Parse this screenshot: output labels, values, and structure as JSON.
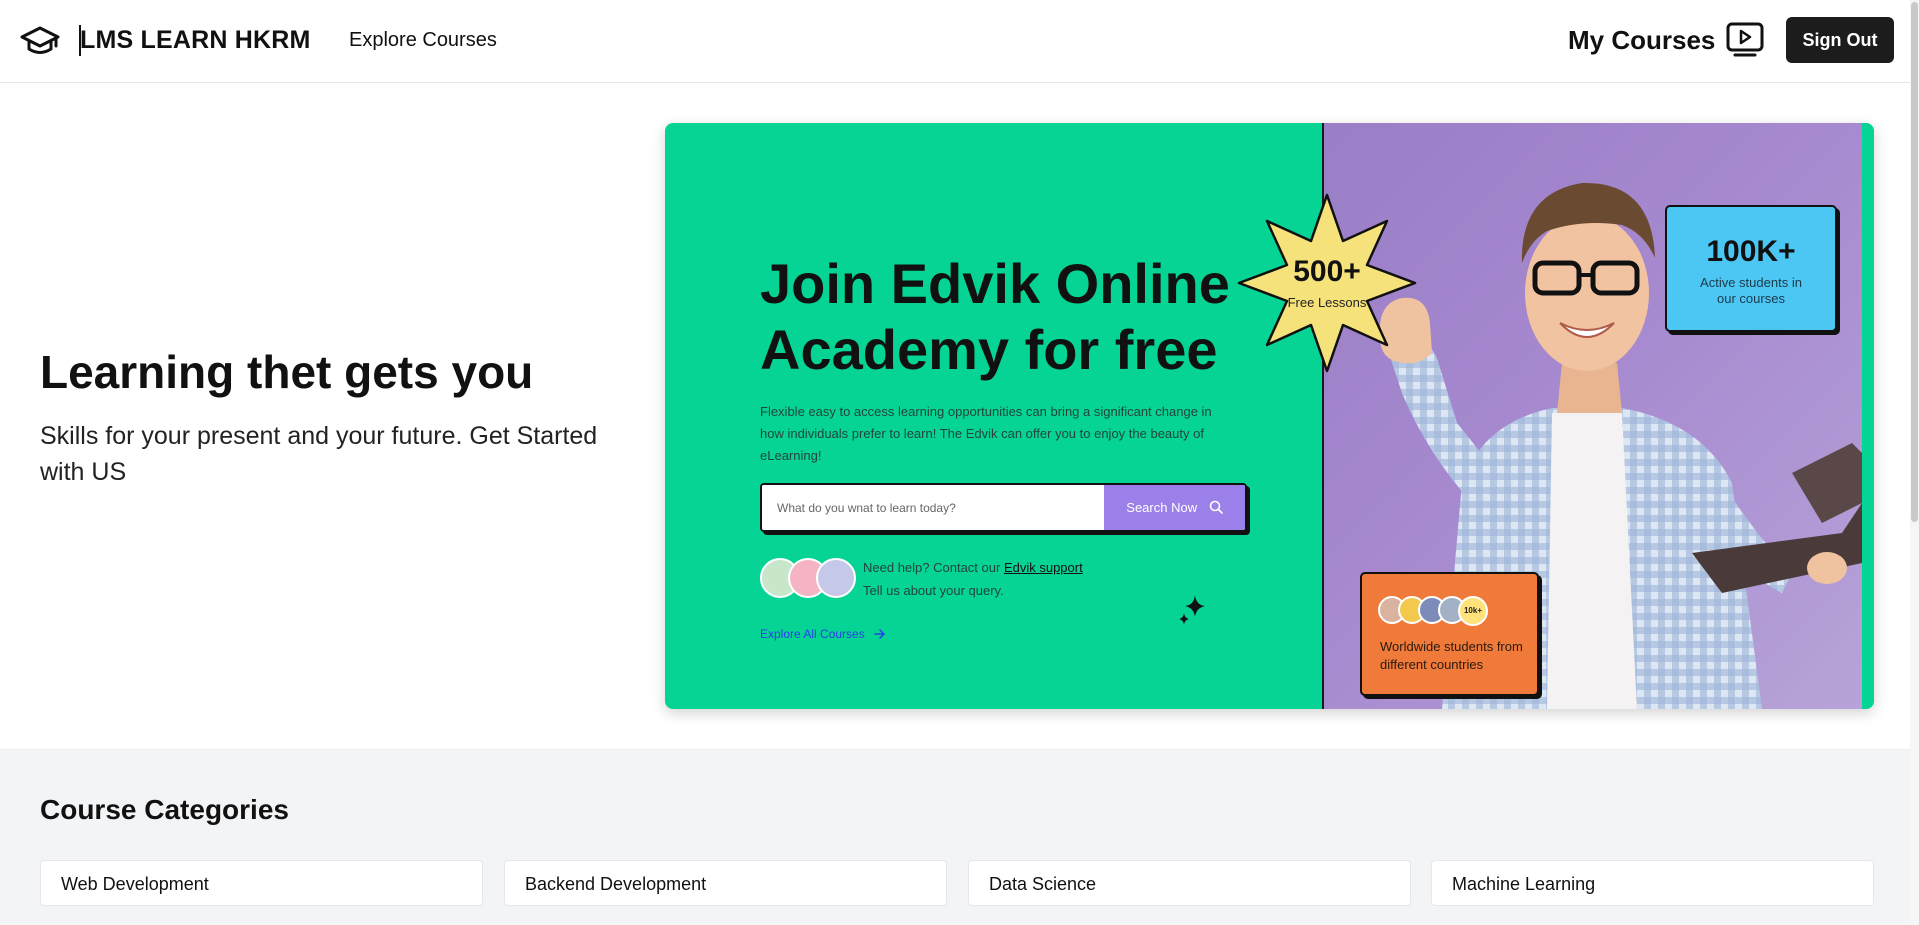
{
  "header": {
    "brand": "LMS LEARN HKRM",
    "nav_explore": "Explore Courses",
    "my_courses": "My Courses",
    "sign_out": "Sign Out",
    "icons": [
      "graduation-cap-icon",
      "play-screen-icon"
    ]
  },
  "hero": {
    "title": "Learning thet gets you",
    "subtitle": "Skills for your present and your future. Get Started with US"
  },
  "banner": {
    "title_line1": "Join Edvik Online",
    "title_line2": "Academy for free",
    "description": "Flexible easy to access learning opportunities can bring a significant change in how individuals prefer to learn! The Edvik can offer you to enjoy the beauty of eLearning!",
    "search_placeholder": "What do you wnat to learn today?",
    "search_button": "Search Now",
    "help_prefix": "Need help? Contact our ",
    "help_link": "Edvik support",
    "help_line2": "Tell us about your query.",
    "explore_all": "Explore All Courses",
    "badge_number": "500+",
    "badge_label": "Free Lessons",
    "stat_number": "100K+",
    "stat_label": "Active students in our courses",
    "worldwide_badge": "10k+",
    "worldwide_text": "Worldwide students from different countries",
    "colors": {
      "green": "#05d494",
      "purple": "#a689cf",
      "blue": "#4cc7f4",
      "orange": "#ef7a3a",
      "star": "#f6e27a",
      "button": "#9a80e8"
    }
  },
  "categories": {
    "title": "Course Categories",
    "items": [
      "Web Development",
      "Backend Development",
      "Data Science",
      "Machine Learning"
    ]
  }
}
